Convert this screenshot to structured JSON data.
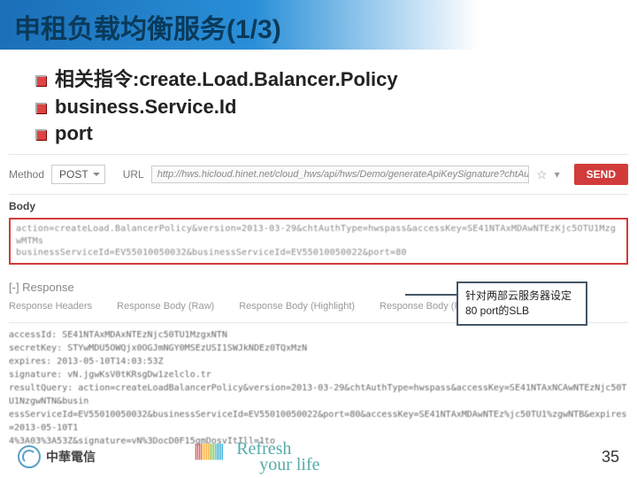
{
  "slide": {
    "title": "申租负载均衡服务(1/3)",
    "bullets": [
      "相关指令:create.Load.Balancer.Policy",
      "business.Service.Id",
      "port"
    ]
  },
  "rest": {
    "methodLabel": "Method",
    "methodValue": "POST",
    "urlLabel": "URL",
    "urlValue": "http://hws.hicloud.hinet.net/cloud_hws/api/hws/Demo/generateApiKeySignature?chtAuthType=a",
    "sendLabel": "SEND",
    "bodyHeader": "Body",
    "bodyLine1": "action=createLoad.BalancerPolicy&version=2013-03-29&chtAuthType=hwspass&accessKey=SE41NTAxMDAwNTEzKjc5OTU1MzgwMTMs",
    "bodyLine2": "businessServiceId=EV55010050032&businessServiceId=EV55010050022&port=80",
    "responseHeader": "[-] Response",
    "tabs": [
      "Response Headers",
      "Response Body (Raw)",
      "Response Body (Highlight)",
      "Response Body (Preview)"
    ],
    "respLines": [
      "accessId: SE41NTAxMDAxNTEzNjc50TU1MzgxNTN",
      "secretKey: STYwMDU5OWQjx0OGJmNGY0MSEzUSI1SWJkNDEz0TQxMzN",
      "expires: 2013-05-10T14:03:53Z",
      "signature: vN.jgwKsV0tKRsgDw1zelclo.tr",
      "resultQuery: action=createLoadBalancerPolicy&version=2013-03-29&chtAuthType=hwspass&accessKey=SE41NTAxNCAwNTEzNjc50TU1NzgwNTN&busin",
      "essServiceId=EV55010050032&businessServiceId=EV55010050022&port=80&accessKey=SE41NTAxMDAwNTEz%jc50TU1%zgwNTB&expires=2013-05-10T1",
      "4%3A03%3A53Z&signature=vN%3DocD0F15gmDosvItIll=1to"
    ]
  },
  "callout": {
    "text": "针对两部云服务器设定80 port的SLB"
  },
  "footer": {
    "company": "中華電信",
    "slogan1": "Refresh",
    "slogan2": "your life",
    "page": "35"
  }
}
